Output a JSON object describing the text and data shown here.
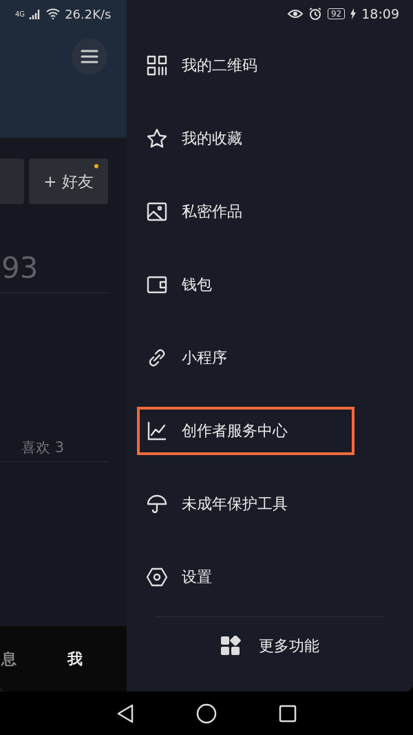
{
  "status_bar": {
    "network": "4G",
    "speed": "26.2K/s",
    "battery": "92",
    "time": "18:09"
  },
  "background_page": {
    "friend_button": {
      "label": "+ 好友",
      "notification": true
    },
    "count": "93",
    "likes_tab": "喜欢 3",
    "bottom_tabs": [
      {
        "label": "息",
        "selected": false
      },
      {
        "label": "我",
        "selected": true
      }
    ]
  },
  "drawer": {
    "items": [
      {
        "kind": "qr",
        "label": "我的二维码",
        "highlighted": false
      },
      {
        "kind": "star",
        "label": "我的收藏",
        "highlighted": false
      },
      {
        "kind": "image",
        "label": "私密作品",
        "highlighted": false
      },
      {
        "kind": "wallet",
        "label": "钱包",
        "highlighted": false
      },
      {
        "kind": "link",
        "label": "小程序",
        "highlighted": false
      },
      {
        "kind": "chart",
        "label": "创作者服务中心",
        "highlighted": true
      },
      {
        "kind": "umbrella",
        "label": "未成年保护工具",
        "highlighted": false
      },
      {
        "kind": "settings",
        "label": "设置",
        "highlighted": false
      }
    ],
    "more": "更多功能"
  }
}
